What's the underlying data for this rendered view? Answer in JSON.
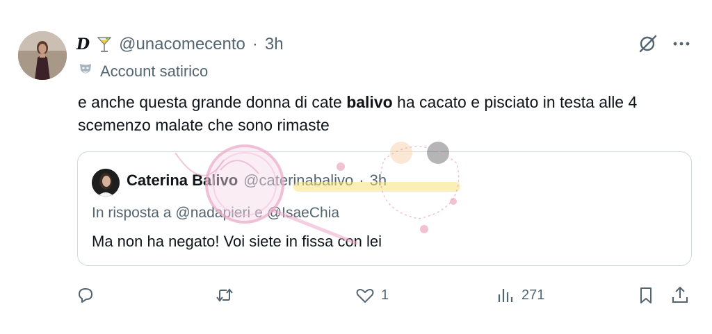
{
  "author": {
    "display_name": "D",
    "handle": "@unacomecento",
    "separator": "·",
    "time": "3h",
    "label": "Account satirico"
  },
  "tweet": {
    "text_before": "e anche questa grande donna di cate ",
    "text_bold": "balivo",
    "text_after": " ha cacato e pisciato in testa alle 4 scemenzo malate che sono rimaste"
  },
  "quoted": {
    "display_name": "Caterina Balivo",
    "handle": "@caterinabalivo",
    "separator": "·",
    "time": "3h",
    "reply_prefix": "In risposta a",
    "reply_user1": "@nadapieri",
    "reply_and": "e",
    "reply_user2": "@IsaeChia",
    "text": "Ma non ha negato! Voi siete in fissa con lei"
  },
  "actions": {
    "reply_count": "",
    "retweet_count": "",
    "like_count": "1",
    "views_count": "271"
  },
  "icons": {
    "cocktail": "cocktail-icon",
    "grok": "grok-icon",
    "more": "more-icon",
    "label": "theater-mask-icon",
    "reply": "reply-icon",
    "retweet": "retweet-icon",
    "like": "heart-icon",
    "views": "views-icon",
    "bookmark": "bookmark-icon",
    "share": "share-icon"
  },
  "colors": {
    "text": "#0f1419",
    "secondary": "#536471",
    "border": "#cfd9de"
  }
}
